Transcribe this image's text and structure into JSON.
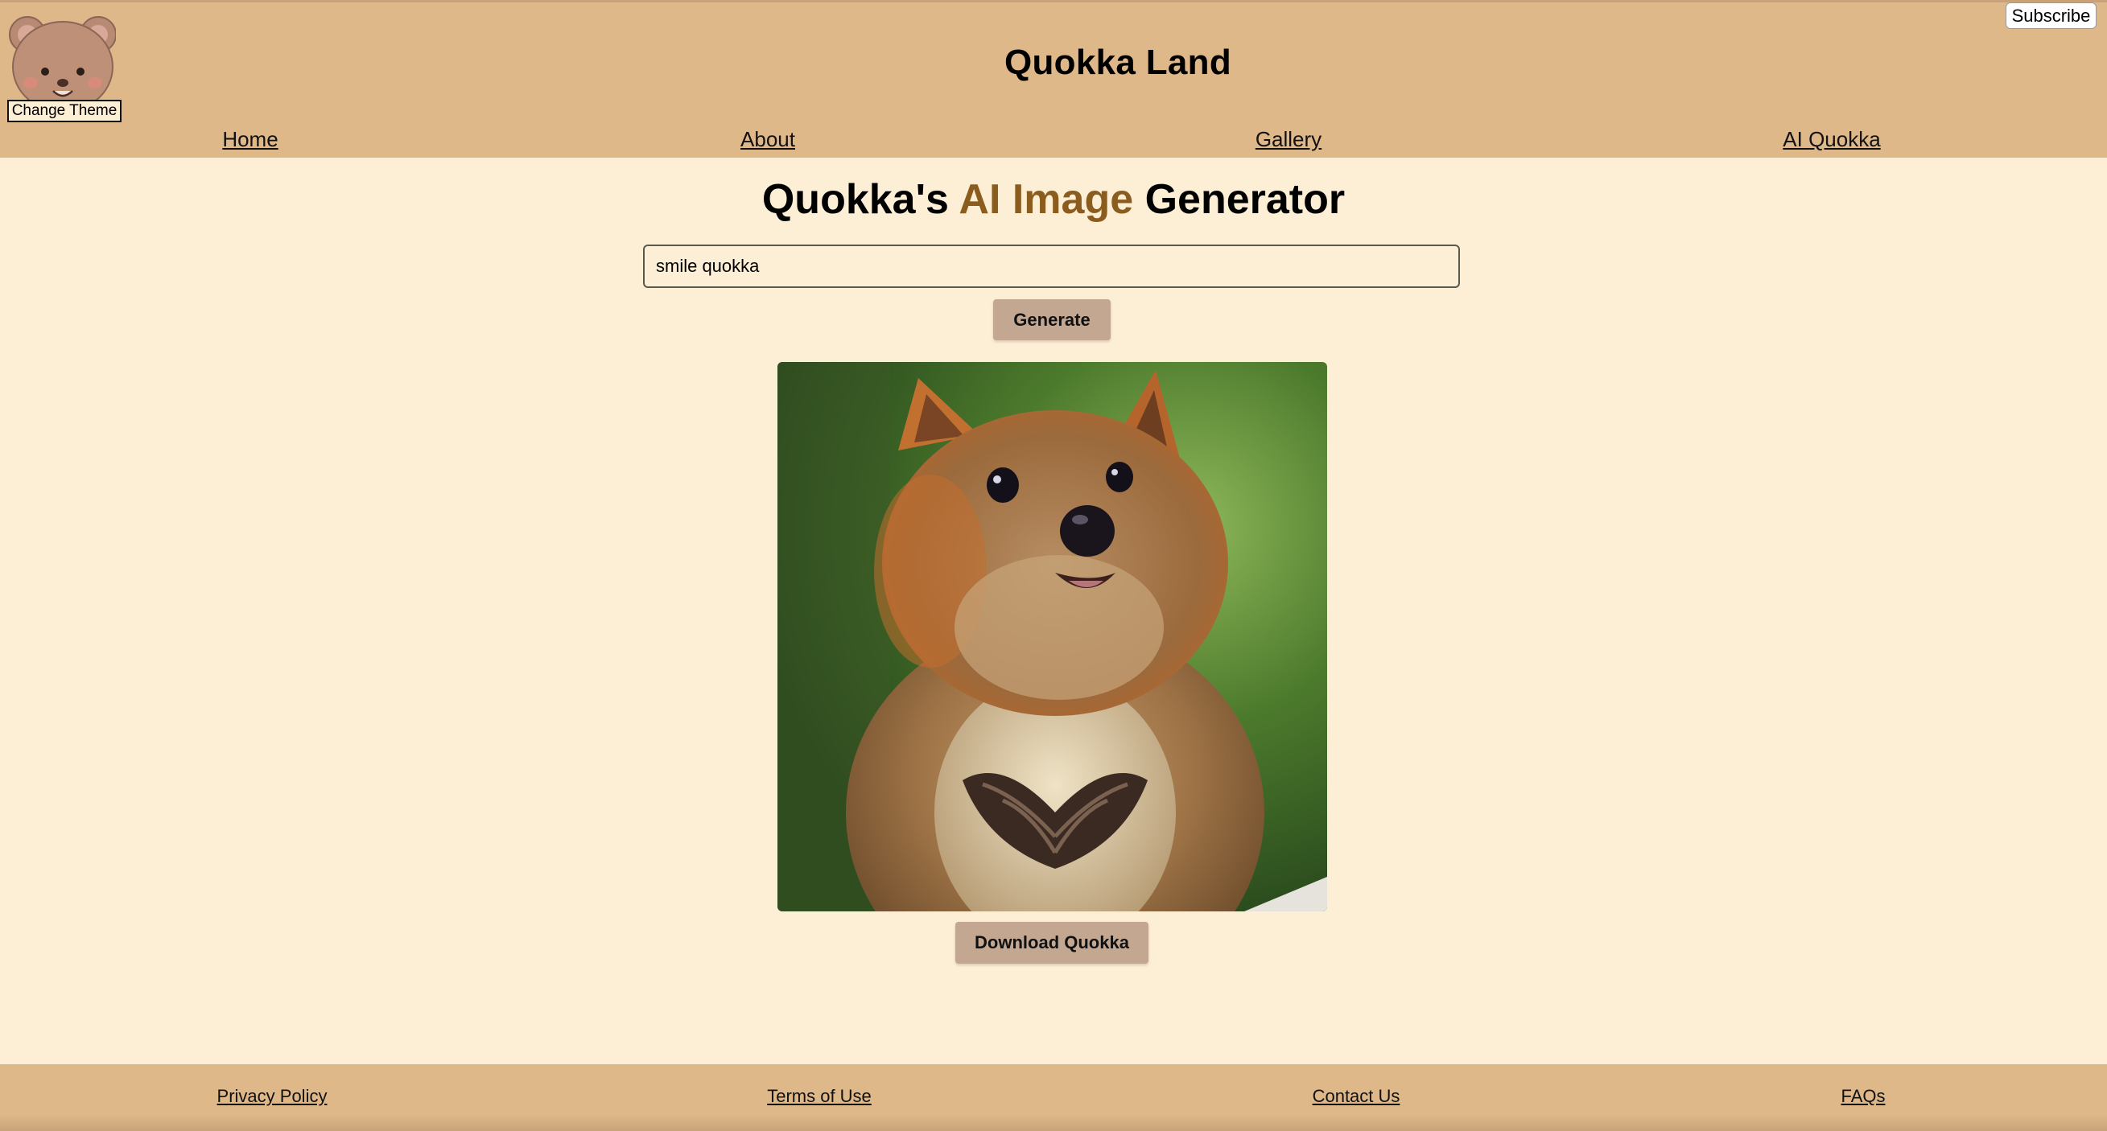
{
  "colors": {
    "header_bg": "#dfb88a",
    "page_bg": "#fdeed6",
    "accent": "#8a5d1e",
    "button_bg": "#c4a791"
  },
  "header": {
    "logo_icon": "quokka-face-logo",
    "theme_button": "Change Theme",
    "subscribe_button": "Subscribe",
    "site_title": "Quokka Land"
  },
  "nav": {
    "items": [
      {
        "label": "Home"
      },
      {
        "label": "About"
      },
      {
        "label": "Gallery"
      },
      {
        "label": "AI Quokka"
      }
    ]
  },
  "main": {
    "heading": {
      "part1": "Quokka's ",
      "accent": "AI Image",
      "part2": " Generator"
    },
    "prompt": {
      "value": "smile quokka"
    },
    "generate_button": "Generate",
    "result_image_icon": "generated-quokka-photo",
    "download_button": "Download Quokka"
  },
  "footer": {
    "links": [
      {
        "label": "Privacy Policy"
      },
      {
        "label": "Terms of Use"
      },
      {
        "label": "Contact Us"
      },
      {
        "label": "FAQs"
      }
    ]
  }
}
